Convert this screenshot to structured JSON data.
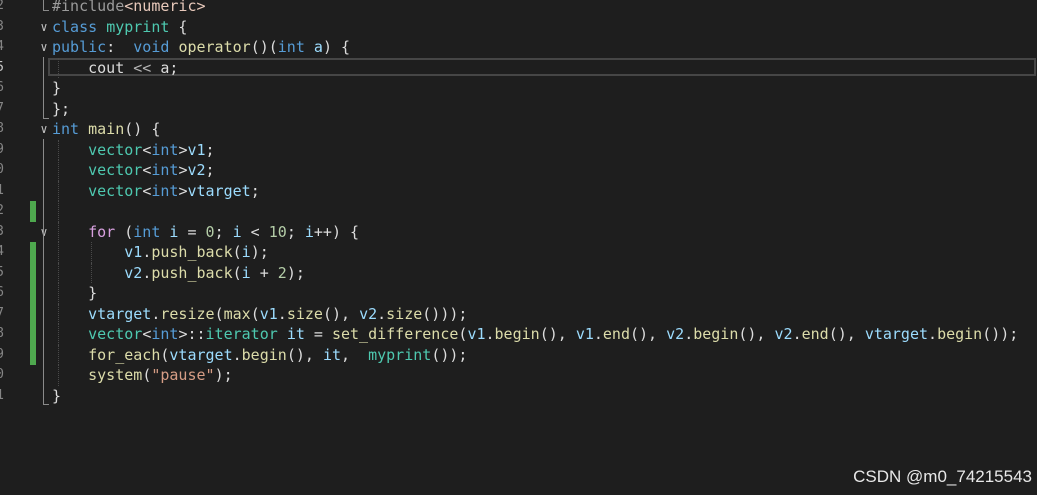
{
  "editor": {
    "lines": [
      {
        "num": "2",
        "fold": "",
        "change": false,
        "current": false,
        "guides": [],
        "tokens": [
          [
            "t-pre",
            "#include"
          ],
          [
            "t-inc",
            "<numeric>"
          ]
        ]
      },
      {
        "num": "3",
        "fold": "v",
        "change": false,
        "current": false,
        "guides": [],
        "tokens": [
          [
            "t-kw",
            "class "
          ],
          [
            "t-type",
            "myprint"
          ],
          [
            "t-plain",
            " {"
          ]
        ]
      },
      {
        "num": "4",
        "fold": "v",
        "change": false,
        "current": false,
        "guides": [],
        "tokens": [
          [
            "t-kw",
            "public"
          ],
          [
            "t-plain",
            ":  "
          ],
          [
            "t-kw",
            "void "
          ],
          [
            "t-fn",
            "operator"
          ],
          [
            "t-plain",
            "()("
          ],
          [
            "t-kw",
            "int "
          ],
          [
            "t-var",
            "a"
          ],
          [
            "t-plain",
            ") {"
          ]
        ]
      },
      {
        "num": "5",
        "fold": "",
        "change": false,
        "current": true,
        "guides": [
          58
        ],
        "tokens": [
          [
            "t-plain",
            "    cout "
          ],
          [
            "t-op",
            "<<"
          ],
          [
            "t-plain",
            " a;"
          ]
        ]
      },
      {
        "num": "6",
        "fold": "",
        "change": false,
        "current": false,
        "guides": [],
        "tokens": [
          [
            "t-plain",
            "}"
          ]
        ]
      },
      {
        "num": "7",
        "fold": "",
        "change": false,
        "current": false,
        "guides": [],
        "tokens": [
          [
            "t-plain",
            "};"
          ]
        ]
      },
      {
        "num": "8",
        "fold": "v",
        "change": false,
        "current": false,
        "guides": [],
        "tokens": [
          [
            "t-kw",
            "int "
          ],
          [
            "t-fn",
            "main"
          ],
          [
            "t-plain",
            "() {"
          ]
        ]
      },
      {
        "num": "9",
        "fold": "",
        "change": false,
        "current": false,
        "guides": [
          58
        ],
        "tokens": [
          [
            "t-plain",
            "    "
          ],
          [
            "t-type",
            "vector"
          ],
          [
            "t-plain",
            "<"
          ],
          [
            "t-kw",
            "int"
          ],
          [
            "t-plain",
            ">"
          ],
          [
            "t-var",
            "v1"
          ],
          [
            "t-plain",
            ";"
          ]
        ]
      },
      {
        "num": "0",
        "fold": "",
        "change": false,
        "current": false,
        "guides": [
          58
        ],
        "tokens": [
          [
            "t-plain",
            "    "
          ],
          [
            "t-type",
            "vector"
          ],
          [
            "t-plain",
            "<"
          ],
          [
            "t-kw",
            "int"
          ],
          [
            "t-plain",
            ">"
          ],
          [
            "t-var",
            "v2"
          ],
          [
            "t-plain",
            ";"
          ]
        ]
      },
      {
        "num": "1",
        "fold": "",
        "change": false,
        "current": false,
        "guides": [
          58
        ],
        "tokens": [
          [
            "t-plain",
            "    "
          ],
          [
            "t-type",
            "vector"
          ],
          [
            "t-plain",
            "<"
          ],
          [
            "t-kw",
            "int"
          ],
          [
            "t-plain",
            ">"
          ],
          [
            "t-var",
            "vtarget"
          ],
          [
            "t-plain",
            ";"
          ]
        ]
      },
      {
        "num": "2",
        "fold": "",
        "change": true,
        "current": false,
        "guides": [
          58
        ],
        "tokens": []
      },
      {
        "num": "3",
        "fold": "v",
        "change": false,
        "current": false,
        "guides": [
          58
        ],
        "tokens": [
          [
            "t-plain",
            "    "
          ],
          [
            "t-ctl",
            "for"
          ],
          [
            "t-plain",
            " ("
          ],
          [
            "t-kw",
            "int "
          ],
          [
            "t-var",
            "i"
          ],
          [
            "t-plain",
            " = "
          ],
          [
            "t-num",
            "0"
          ],
          [
            "t-plain",
            "; "
          ],
          [
            "t-var",
            "i"
          ],
          [
            "t-plain",
            " < "
          ],
          [
            "t-num",
            "10"
          ],
          [
            "t-plain",
            "; "
          ],
          [
            "t-var",
            "i"
          ],
          [
            "t-plain",
            "++) {"
          ]
        ]
      },
      {
        "num": "4",
        "fold": "",
        "change": true,
        "current": false,
        "guides": [
          58,
          91
        ],
        "tokens": [
          [
            "t-plain",
            "        "
          ],
          [
            "t-var",
            "v1"
          ],
          [
            "t-plain",
            "."
          ],
          [
            "t-fn",
            "push_back"
          ],
          [
            "t-plain",
            "("
          ],
          [
            "t-var",
            "i"
          ],
          [
            "t-plain",
            ");"
          ]
        ]
      },
      {
        "num": "5",
        "fold": "",
        "change": true,
        "current": false,
        "guides": [
          58,
          91
        ],
        "tokens": [
          [
            "t-plain",
            "        "
          ],
          [
            "t-var",
            "v2"
          ],
          [
            "t-plain",
            "."
          ],
          [
            "t-fn",
            "push_back"
          ],
          [
            "t-plain",
            "("
          ],
          [
            "t-var",
            "i"
          ],
          [
            "t-plain",
            " + "
          ],
          [
            "t-num",
            "2"
          ],
          [
            "t-plain",
            ");"
          ]
        ]
      },
      {
        "num": "6",
        "fold": "",
        "change": true,
        "current": false,
        "guides": [
          58
        ],
        "tokens": [
          [
            "t-plain",
            "    }"
          ]
        ]
      },
      {
        "num": "7",
        "fold": "",
        "change": true,
        "current": false,
        "guides": [
          58
        ],
        "tokens": [
          [
            "t-plain",
            "    "
          ],
          [
            "t-var",
            "vtarget"
          ],
          [
            "t-plain",
            "."
          ],
          [
            "t-fn",
            "resize"
          ],
          [
            "t-plain",
            "("
          ],
          [
            "t-fn",
            "max"
          ],
          [
            "t-plain",
            "("
          ],
          [
            "t-var",
            "v1"
          ],
          [
            "t-plain",
            "."
          ],
          [
            "t-fn",
            "size"
          ],
          [
            "t-plain",
            "(), "
          ],
          [
            "t-var",
            "v2"
          ],
          [
            "t-plain",
            "."
          ],
          [
            "t-fn",
            "size"
          ],
          [
            "t-plain",
            "()));"
          ]
        ]
      },
      {
        "num": "8",
        "fold": "",
        "change": true,
        "current": false,
        "guides": [
          58
        ],
        "tokens": [
          [
            "t-plain",
            "    "
          ],
          [
            "t-type",
            "vector"
          ],
          [
            "t-plain",
            "<"
          ],
          [
            "t-kw",
            "int"
          ],
          [
            "t-plain",
            ">::"
          ],
          [
            "t-type",
            "iterator"
          ],
          [
            "t-plain",
            " "
          ],
          [
            "t-var",
            "it"
          ],
          [
            "t-plain",
            " = "
          ],
          [
            "t-fn",
            "set_difference"
          ],
          [
            "t-plain",
            "("
          ],
          [
            "t-var",
            "v1"
          ],
          [
            "t-plain",
            "."
          ],
          [
            "t-fn",
            "begin"
          ],
          [
            "t-plain",
            "(), "
          ],
          [
            "t-var",
            "v1"
          ],
          [
            "t-plain",
            "."
          ],
          [
            "t-fn",
            "end"
          ],
          [
            "t-plain",
            "(), "
          ],
          [
            "t-var",
            "v2"
          ],
          [
            "t-plain",
            "."
          ],
          [
            "t-fn",
            "begin"
          ],
          [
            "t-plain",
            "(), "
          ],
          [
            "t-var",
            "v2"
          ],
          [
            "t-plain",
            "."
          ],
          [
            "t-fn",
            "end"
          ],
          [
            "t-plain",
            "(), "
          ],
          [
            "t-var",
            "vtarget"
          ],
          [
            "t-plain",
            "."
          ],
          [
            "t-fn",
            "begin"
          ],
          [
            "t-plain",
            "());"
          ]
        ]
      },
      {
        "num": "9",
        "fold": "",
        "change": true,
        "current": false,
        "guides": [
          58
        ],
        "tokens": [
          [
            "t-plain",
            "    "
          ],
          [
            "t-fn",
            "for_each"
          ],
          [
            "t-plain",
            "("
          ],
          [
            "t-var",
            "vtarget"
          ],
          [
            "t-plain",
            "."
          ],
          [
            "t-fn",
            "begin"
          ],
          [
            "t-plain",
            "(), "
          ],
          [
            "t-var",
            "it"
          ],
          [
            "t-plain",
            ",  "
          ],
          [
            "t-type",
            "myprint"
          ],
          [
            "t-plain",
            "());"
          ]
        ]
      },
      {
        "num": "0",
        "fold": "",
        "change": false,
        "current": false,
        "guides": [
          58
        ],
        "tokens": [
          [
            "t-plain",
            "    "
          ],
          [
            "t-fn",
            "system"
          ],
          [
            "t-plain",
            "("
          ],
          [
            "t-str",
            "\"pause\""
          ],
          [
            "t-plain",
            ");"
          ]
        ]
      },
      {
        "num": "1",
        "fold": "",
        "change": false,
        "current": false,
        "guides": [],
        "tokens": [
          [
            "t-plain",
            "}"
          ]
        ]
      }
    ]
  },
  "watermark": "CSDN @m0_74215543"
}
